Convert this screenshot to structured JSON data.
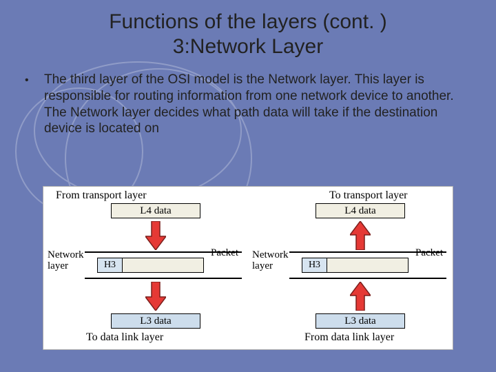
{
  "title_line1": "Functions of the layers (cont. )",
  "title_line2": "3:Network Layer",
  "bullet_text": "The third layer of the OSI model is the Network layer. This layer is responsible for routing information from one network device to another. The Network layer decides what path data will take if the destination device is located on",
  "diagram": {
    "left": {
      "top_caption": "From transport layer",
      "l4_label": "L4 data",
      "row_label": "Network\nlayer",
      "packet_label": "Packet",
      "h3_label": "H3",
      "l3_label": "L3 data",
      "bottom_caption": "To data link layer",
      "arrow_dir": "down"
    },
    "right": {
      "top_caption": "To transport layer",
      "l4_label": "L4 data",
      "row_label": "Network\nlayer",
      "packet_label": "Packet",
      "h3_label": "H3",
      "l3_label": "L3 data",
      "bottom_caption": "From data link layer",
      "arrow_dir": "up"
    }
  },
  "colors": {
    "slide_bg": "#6b7bb5",
    "arrow_fill": "#e53935",
    "arrow_stroke": "#7b1f1c",
    "l4_fill": "#f1efe3",
    "pkt_fill": "#d7e4f0"
  }
}
